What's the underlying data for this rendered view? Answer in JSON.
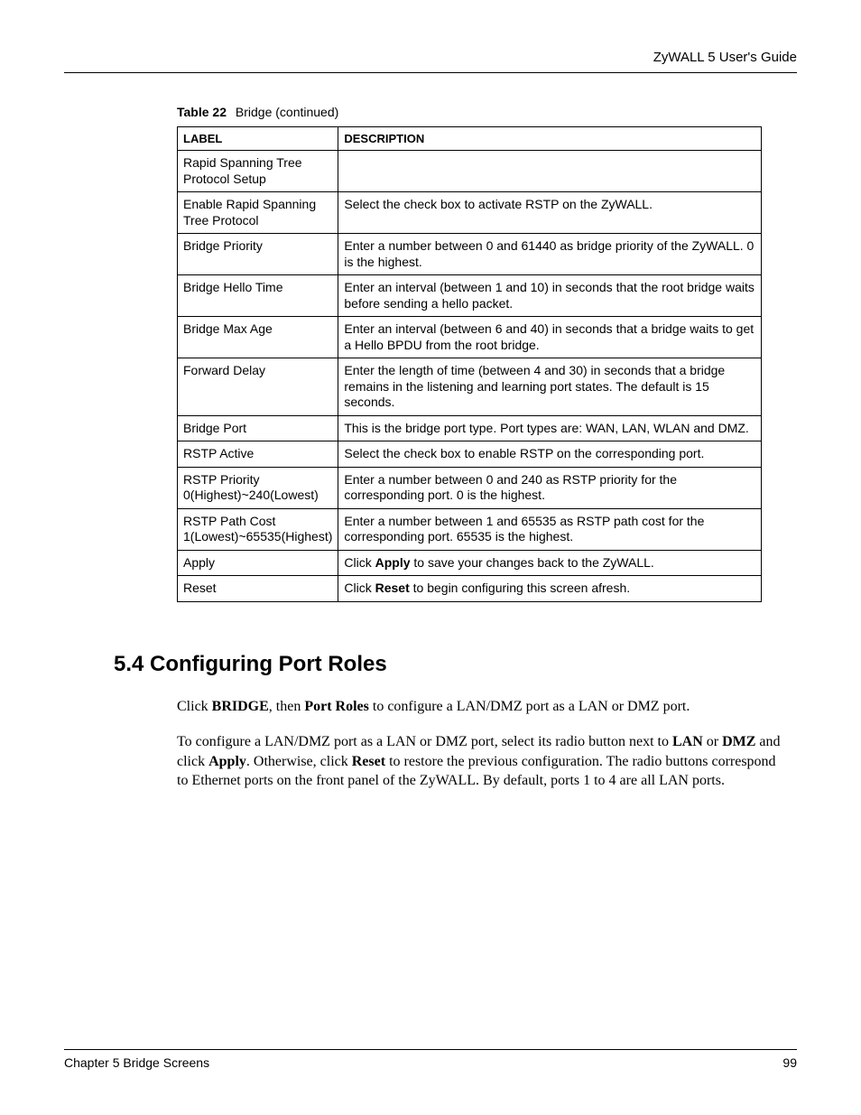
{
  "header": {
    "title": "ZyWALL 5 User's Guide"
  },
  "tableCaption": {
    "bold": "Table 22",
    "rest": "Bridge  (continued)"
  },
  "tableHeaders": {
    "label": "LABEL",
    "description": "DESCRIPTION"
  },
  "rows": {
    "r0_label": "Rapid Spanning Tree Protocol Setup",
    "r0_desc": "",
    "r1_label": "Enable Rapid Spanning Tree Protocol",
    "r1_desc": "Select the check box to activate RSTP on the ZyWALL.",
    "r2_label": "Bridge Priority",
    "r2_desc": "Enter a number between 0 and 61440 as bridge priority of the ZyWALL. 0 is the highest.",
    "r3_label": "Bridge Hello Time",
    "r3_desc_a": "Enter an ",
    "r3_desc_b": "interval (between 1 and 10) in seconds that the root bridge waits before sending a hello packet.",
    "r4_label": "Bridge Max Age",
    "r4_desc_a": "Enter an interval ",
    "r4_desc_b": "(between 6 and 40) in seconds ",
    "r4_desc_c": "that a bridge waits to get a Hello BPDU from the root bridge.",
    "r5_label": "Forward Delay",
    "r5_desc_a": "Enter the length of time ",
    "r5_desc_b": "(between 4 and 30) in seconds ",
    "r5_desc_c": "that a bridge remains in the listening and learning port states. The default is 15 seconds.",
    "r6_label": "Bridge Port",
    "r6_desc": "This is the bridge port type. Port types are: WAN, LAN, WLAN and DMZ.",
    "r7_label": "RSTP Active",
    "r7_desc": "Select the check box to enable RSTP on the corresponding port.",
    "r8_label": "RSTP Priority 0(Highest)~240(Lowest)",
    "r8_desc": "Enter a number between 0 and 240 as RSTP priority for the corresponding port. 0 is the highest.",
    "r9_label": "RSTP Path Cost 1(Lowest)~65535(Highest)",
    "r9_desc": "Enter a number between 1 and 65535 as RSTP path cost for the corresponding port. 65535 is the highest.",
    "r10_label": "Apply",
    "r10_desc_a": "Click ",
    "r10_desc_b": "Apply",
    "r10_desc_c": " to save your changes back to the ZyWALL.",
    "r11_label": "Reset",
    "r11_desc_a": "Click ",
    "r11_desc_b": "Reset",
    "r11_desc_c": " to begin configuring this screen afresh."
  },
  "section": {
    "heading": "5.4  Configuring Port Roles",
    "p1_a": "Click ",
    "p1_b": "BRIDGE",
    "p1_c": ", then ",
    "p1_d": "Port Roles",
    "p1_e": " to configure a LAN/DMZ port as a LAN or DMZ port.",
    "p2_a": "To configure a LAN/DMZ port as a LAN or DMZ port, select its radio button next to ",
    "p2_b": "LAN",
    "p2_c": " or ",
    "p2_d": "DMZ",
    "p2_e": " and click ",
    "p2_f": "Apply",
    "p2_g": ". Otherwise, click ",
    "p2_h": "Reset",
    "p2_i": " to restore the previous configuration. The radio buttons correspond to Ethernet ports on the front panel of the ZyWALL. By default, ports 1 to 4 are all LAN ports."
  },
  "footer": {
    "chapter": "Chapter 5 Bridge Screens",
    "page": "99"
  }
}
